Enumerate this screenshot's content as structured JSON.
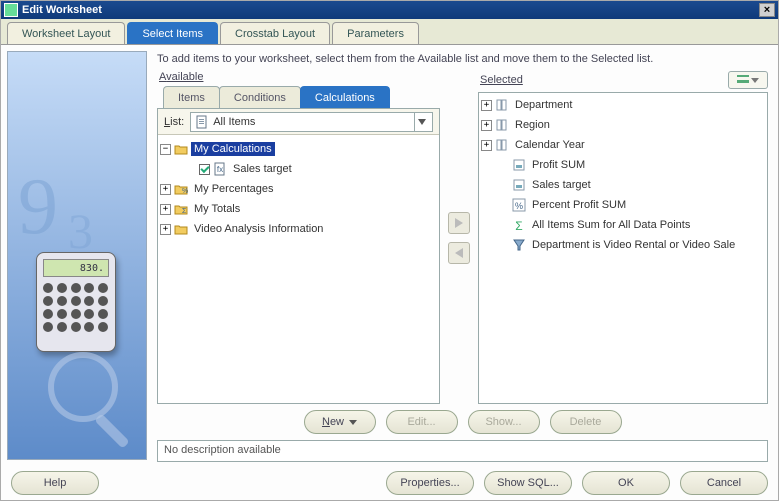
{
  "window": {
    "title": "Edit Worksheet"
  },
  "tabs": [
    "Worksheet Layout",
    "Select Items",
    "Crosstab Layout",
    "Parameters"
  ],
  "instruction": "To add items to your worksheet, select them from the Available list and move them to the Selected list.",
  "side": {
    "calc_display": "830."
  },
  "available": {
    "header": "Available",
    "subtabs": [
      "Items",
      "Conditions",
      "Calculations"
    ],
    "list_label": "List:",
    "list_value": "All Items",
    "tree": [
      {
        "label": "My Calculations",
        "expanded": true,
        "selected": true,
        "children": [
          {
            "label": "Sales target",
            "checked": true
          }
        ]
      },
      {
        "label": "My Percentages",
        "expanded": false
      },
      {
        "label": "My Totals",
        "expanded": false
      },
      {
        "label": "Video Analysis Information",
        "expanded": false
      }
    ]
  },
  "selected": {
    "header": "Selected",
    "items": [
      {
        "label": "Department",
        "type": "dimension"
      },
      {
        "label": "Region",
        "type": "dimension"
      },
      {
        "label": "Calendar Year",
        "type": "dimension"
      },
      {
        "label": "Profit SUM",
        "type": "measure"
      },
      {
        "label": "Sales target",
        "type": "measure"
      },
      {
        "label": "Percent Profit SUM",
        "type": "percent"
      },
      {
        "label": "All Items Sum for All Data Points",
        "type": "total"
      },
      {
        "label": "Department is Video Rental or Video Sale",
        "type": "condition"
      }
    ]
  },
  "buttons": {
    "new": "New",
    "edit": "Edit...",
    "show": "Show...",
    "delete": "Delete"
  },
  "description": "No description available",
  "footer": {
    "help": "Help",
    "properties": "Properties...",
    "show_sql": "Show SQL...",
    "ok": "OK",
    "cancel": "Cancel"
  }
}
